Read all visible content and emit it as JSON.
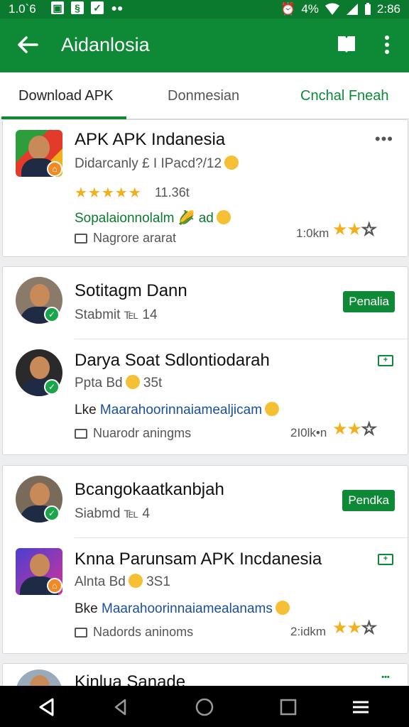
{
  "status": {
    "time_left": "1.0`6",
    "time_right": "2:86",
    "battery": "4%"
  },
  "appbar": {
    "title": "Aidanlosia"
  },
  "tabs": [
    {
      "label": "Download APK"
    },
    {
      "label": "Donmesian"
    },
    {
      "label": "Cnchal Fneah"
    }
  ],
  "item1": {
    "name": "APK APK Indanesia",
    "sub": "Didarcanly £ I IPacd?/12",
    "stars": "★★★★★",
    "rating_value": 5,
    "rating": "11.36t",
    "desc": "Sopalaionnolalm 🌽 ad",
    "meta": "Nagrore ararat",
    "dist": "1:0km",
    "more": "•••"
  },
  "item2": {
    "name": "Sotitagm Dann",
    "sub": "Stabmit ℡ 14",
    "pill": "Penalia"
  },
  "item3": {
    "name": "Darya Soat Sdlontiodarah",
    "sub": "Ppta Bd",
    "sub_count": "35t",
    "desc_prefix": "Lke ",
    "desc_link": "Maarahoorinnaiamealjicam",
    "meta": "Nuarodr aningms",
    "dist": "2I0lk•n"
  },
  "item4": {
    "name": "Bcangokaatkanbjah",
    "sub": "Siabmd ℡ 4",
    "pill": "Pendka"
  },
  "item5": {
    "name": "Knna Parunsam APK Incdanesia",
    "sub": "Alnta Bd",
    "sub_count": "3S1",
    "desc_prefix": "Bke ",
    "desc_link": "Maarahoorinnaiamealanams",
    "meta": "Nadords aninoms",
    "dist": "2:idkm"
  },
  "item6": {
    "name": "Kinlua Sanade"
  },
  "colors": {
    "primary": "#0e8a37",
    "statusbar": "#0b7a2f",
    "star": "#f2b01e"
  }
}
